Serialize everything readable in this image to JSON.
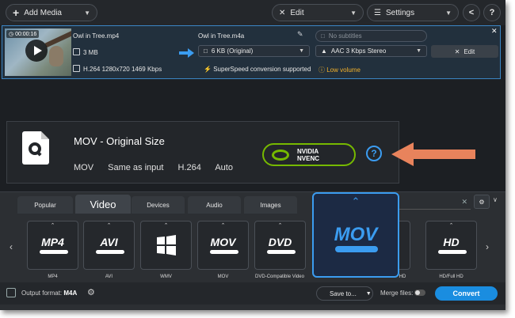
{
  "toolbar": {
    "add_media_label": "Add Media",
    "edit_label": "Edit",
    "settings_label": "Settings"
  },
  "file": {
    "duration": "00:00:16",
    "source_name": "Owl in Tree.mp4",
    "source_size": "3 MB",
    "source_info": "H.264 1280x720 1469 Kbps",
    "output_name": "Owl in Tree.m4a",
    "output_size": "6 KB (Original)",
    "superspeed_note": "SuperSpeed conversion supported",
    "subtitles_placeholder": "No subtitles",
    "audio_track": "AAC 3 Kbps Stereo",
    "low_volume_warning": "Low volume",
    "edit_label": "Edit"
  },
  "preset_info": {
    "title": "MOV - Original Size",
    "container": "MOV",
    "resolution": "Same as input",
    "codec": "H.264",
    "bitrate": "Auto",
    "nvenc_line1": "NVIDIA",
    "nvenc_line2": "NVENC",
    "help_label": "?"
  },
  "tabs": [
    "Popular",
    "Video",
    "Devices",
    "Audio",
    "Images"
  ],
  "active_tab": "Video",
  "formats": [
    {
      "logo": "MP4",
      "label": "MP4"
    },
    {
      "logo": "AVI",
      "label": "AVI"
    },
    {
      "logo": "WMV",
      "label": "WMV"
    },
    {
      "logo": "MOV",
      "label": "MOV"
    },
    {
      "logo": "DVD",
      "label": "DVD-Compatible Video"
    },
    {
      "logo": "",
      "label": "HD"
    },
    {
      "logo": "HD",
      "label": "HD/Full HD"
    }
  ],
  "selected_format": {
    "logo": "MOV"
  },
  "bottom": {
    "output_format_label": "Output format:",
    "output_format_value": "M4A",
    "save_to_label": "Save to...",
    "merge_label": "Merge files:",
    "convert_label": "Convert"
  },
  "colors": {
    "accent_blue": "#3b9cf0",
    "nvidia_green": "#76b900",
    "warning_yellow": "#f3b12a",
    "callout_orange": "#e8835c",
    "convert_blue": "#1a8de0"
  }
}
